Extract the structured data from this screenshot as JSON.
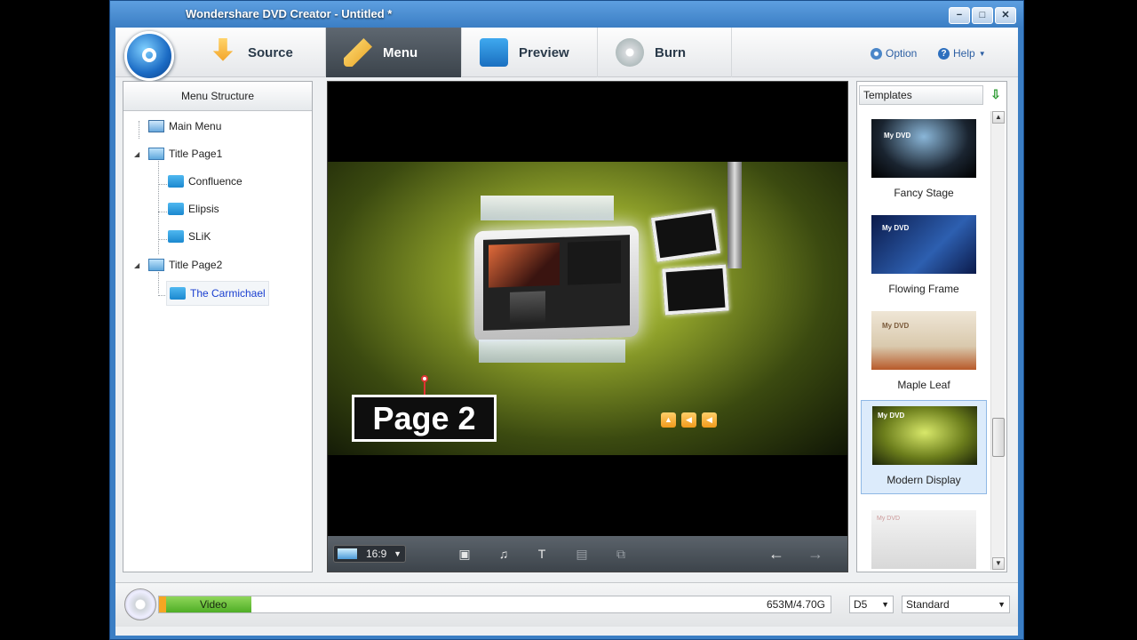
{
  "window": {
    "title": "Wondershare DVD Creator - Untitled *",
    "minimize": "−",
    "maximize": "□",
    "close": "✕"
  },
  "nav": {
    "tabs": [
      {
        "label": "Source",
        "icon": "download-icon",
        "active": false
      },
      {
        "label": "Menu",
        "icon": "pencil-icon",
        "active": true
      },
      {
        "label": "Preview",
        "icon": "clapper-icon",
        "active": false
      },
      {
        "label": "Burn",
        "icon": "disc-burn-icon",
        "active": false
      }
    ],
    "option_label": "Option",
    "help_label": "Help"
  },
  "menu_structure": {
    "header": "Menu Structure",
    "items": [
      {
        "label": "Main Menu",
        "icon": "house-icon"
      },
      {
        "label": "Title Page1",
        "icon": "monitor-icon"
      },
      {
        "label": "Confluence",
        "icon": "folder-icon"
      },
      {
        "label": "Elipsis",
        "icon": "folder-icon"
      },
      {
        "label": "SLiK",
        "icon": "folder-icon"
      },
      {
        "label": "Title Page2",
        "icon": "monitor-icon"
      },
      {
        "label": "The Carmichael",
        "icon": "folder-icon",
        "selected": true
      }
    ]
  },
  "preview": {
    "page_title": "Page 2",
    "aspect_ratio": "16:9"
  },
  "templates": {
    "header": "Templates",
    "items": [
      {
        "name": "Fancy Stage",
        "selected": false
      },
      {
        "name": "Flowing Frame",
        "selected": false
      },
      {
        "name": "Maple Leaf",
        "selected": false
      },
      {
        "name": "Modern Display",
        "selected": true
      },
      {
        "name": "",
        "selected": false
      }
    ]
  },
  "thumb_texts": {
    "my_dvd": "My DVD"
  },
  "status": {
    "bar_label": "Video",
    "capacity": "653M/4.70G",
    "disc_type": "D5",
    "quality": "Standard"
  },
  "colors": {
    "titlebar": "#3b7ec4",
    "active_tab": "#4a525a",
    "selected_text": "#1a3fd0",
    "progress_green": "#4fae26",
    "progress_orange": "#f5a623"
  }
}
